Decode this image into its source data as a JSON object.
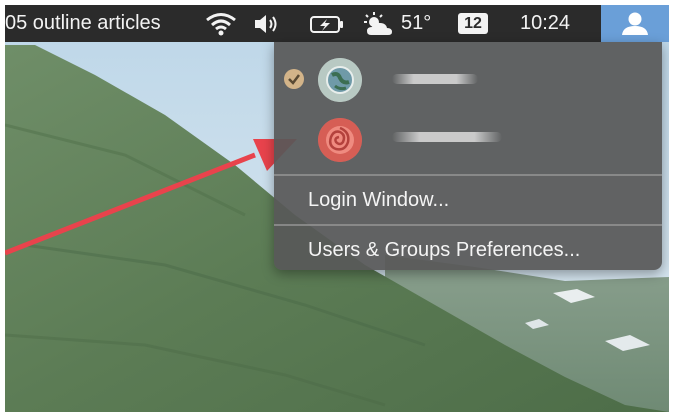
{
  "menubar": {
    "app_title": "05 outline articles",
    "weather_temp": "51°",
    "calendar_day": "12",
    "time": "10:24",
    "icons": [
      "wifi-icon",
      "volume-icon",
      "battery-charging-icon",
      "weather-partly-cloudy-icon",
      "user-icon"
    ]
  },
  "user_menu": {
    "users": [
      {
        "avatar": "globe-avatar",
        "checked": true
      },
      {
        "avatar": "rose-avatar",
        "checked": false
      }
    ],
    "login_window": "Login Window...",
    "users_groups_prefs": "Users & Groups Preferences..."
  },
  "colors": {
    "menubar_bg": "#2b2b2b",
    "user_button_bg": "#6a9fd8",
    "dropdown_bg": "#585858",
    "arrow": "#e8434c",
    "checkmark_badge": "#d3b489"
  }
}
